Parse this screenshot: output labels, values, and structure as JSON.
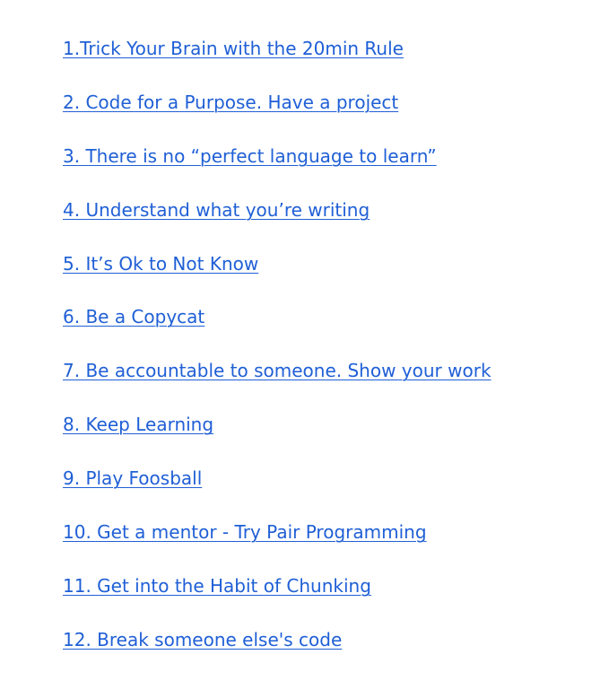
{
  "toc": {
    "items": [
      {
        "label": "1.Trick Your Brain with the 20min Rule"
      },
      {
        "label": "2. Code for a Purpose. Have a project"
      },
      {
        "label": "3. There is no “perfect language to learn”"
      },
      {
        "label": "4. Understand what you’re writing"
      },
      {
        "label": "5. It’s Ok to Not Know"
      },
      {
        "label": "6. Be a Copycat"
      },
      {
        "label": "7. Be accountable to someone. Show your work"
      },
      {
        "label": "8. Keep Learning"
      },
      {
        "label": "9. Play Foosball"
      },
      {
        "label": "10. Get a mentor - Try Pair Programming"
      },
      {
        "label": "11. Get into the Habit of Chunking"
      },
      {
        "label": "12. Break someone else's code"
      }
    ]
  },
  "colors": {
    "link": "#1f5fd6",
    "background": "#ffffff"
  }
}
